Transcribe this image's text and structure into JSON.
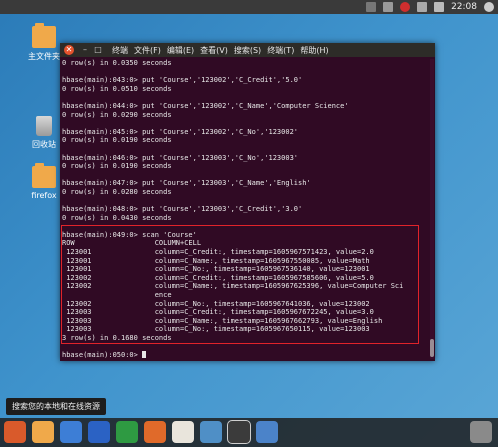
{
  "top_panel": {
    "clock": "22:08",
    "tray_icons": [
      "settings-icon",
      "network-icon",
      "no-entry-icon",
      "mail-icon",
      "volume-icon",
      "power-icon"
    ]
  },
  "desktop_icons": [
    {
      "name": "home-folder",
      "label": "主文件夹",
      "icon": "folder-icon"
    },
    {
      "name": "trash",
      "label": "回收站",
      "icon": "trash-icon"
    },
    {
      "name": "firefox-folder",
      "label": "firefox",
      "icon": "folder-icon"
    }
  ],
  "terminal": {
    "menu": [
      "终端",
      "文件(F)",
      "编辑(E)",
      "查看(V)",
      "搜索(S)",
      "终端(T)",
      "帮助(H)"
    ],
    "lines": [
      "0 row(s) in 0.0350 seconds",
      "",
      "hbase(main):043:0> put 'Course','123002','C_Credit','5.0'",
      "0 row(s) in 0.0510 seconds",
      "",
      "hbase(main):044:0> put 'Course','123002','C_Name','Computer Science'",
      "0 row(s) in 0.0290 seconds",
      "",
      "hbase(main):045:0> put 'Course','123002','C_No','123002'",
      "0 row(s) in 0.0190 seconds",
      "",
      "hbase(main):046:0> put 'Course','123003','C_No','123003'",
      "0 row(s) in 0.0190 seconds",
      "",
      "hbase(main):047:0> put 'Course','123003','C_Name','English'",
      "0 row(s) in 0.0280 seconds",
      "",
      "hbase(main):048:0> put 'Course','123003','C_Credit','3.0'",
      "0 row(s) in 0.0430 seconds",
      "",
      "hbase(main):049:0> scan 'Course'",
      "ROW                   COLUMN+CELL",
      " 123001               column=C_Credit:, timestamp=1605967571423, value=2.0",
      " 123001               column=C_Name:, timestamp=1605967550085, value=Math",
      " 123001               column=C_No:, timestamp=1605967536140, value=123001",
      " 123002               column=C_Credit:, timestamp=1605967585606, value=5.0",
      " 123002               column=C_Name:, timestamp=1605967625396, value=Computer Sci",
      "                      ence",
      " 123002               column=C_No:, timestamp=1605967641036, value=123002",
      " 123003               column=C_Credit:, timestamp=1605967672245, value=3.0",
      " 123003               column=C_Name:, timestamp=1605967662793, value=English",
      " 123003               column=C_No:, timestamp=1605967650115, value=123003",
      "3 row(s) in 0.1680 seconds",
      "",
      "hbase(main):050:0> "
    ]
  },
  "tooltip": "搜索您的本地和在线资源",
  "dock_items": [
    {
      "name": "dash-icon",
      "color": "#d95a2b"
    },
    {
      "name": "files-icon",
      "color": "#f0a94a"
    },
    {
      "name": "chromium-icon",
      "color": "#3d7ed6"
    },
    {
      "name": "writer-icon",
      "color": "#2b62c4"
    },
    {
      "name": "spreadsheet-icon",
      "color": "#2e9a42"
    },
    {
      "name": "presentation-icon",
      "color": "#e06a2a"
    },
    {
      "name": "software-center-icon",
      "color": "#e9e5dc"
    },
    {
      "name": "mail-client-icon",
      "color": "#4f8fc6"
    },
    {
      "name": "terminal-icon",
      "color": "#3b3b3b"
    },
    {
      "name": "workspace-switcher-icon",
      "color": "#4b83c9"
    },
    {
      "name": "trash-dock-icon",
      "color": "#8a8a8a"
    }
  ]
}
